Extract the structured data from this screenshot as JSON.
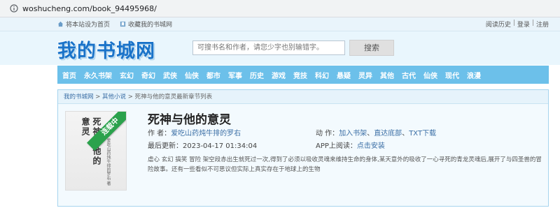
{
  "browser": {
    "url": "woshucheng.com/book_94495968/"
  },
  "topbar": {
    "set_home": "将本站设为首页",
    "bookmark": "收藏我的书城网",
    "history": "阅读历史",
    "sep1": "|",
    "login": "登录",
    "sep2": "|",
    "register": "注册"
  },
  "header": {
    "logo": "我的书城网",
    "search_placeholder": "可搜书名和作者，请您少字也别输错字。",
    "search_button": "搜索"
  },
  "nav": {
    "items": [
      "首页",
      "永久书架",
      "玄幻",
      "奇幻",
      "武侠",
      "仙侠",
      "都市",
      "军事",
      "历史",
      "游戏",
      "竞技",
      "科幻",
      "悬疑",
      "灵异",
      "其他",
      "古代",
      "仙侠",
      "现代",
      "浪漫"
    ]
  },
  "breadcrumb": {
    "home": "我的书城网",
    "sep1": " > ",
    "category": "其他小说",
    "sep2": " > ",
    "current": "死神与他的意灵最新章节列表"
  },
  "book": {
    "cover_line1": "意灵",
    "cover_line2": "死神与他的",
    "cover_author": "爱吃山药炖牛排的罗右 著",
    "ribbon": "连载中",
    "title": "死神与他的意灵",
    "author_label": "作    者：",
    "author": "爱吃山药炖牛排的罗右",
    "action_label": "动    作：",
    "action_shelf": "加入书架",
    "action_sep": "、",
    "action_bottom": "直达底部",
    "action_sep2": "、",
    "action_txt": "TXT下载",
    "update_label": "最后更新：",
    "update_time": "2023-04-17 01:34:04",
    "app_label": "APP上阅读：",
    "app_link": "点击安装",
    "description": "虐心 玄幻 搞笑 冒险 架空段赤出生就死过一次,得到了必须以吸收灵魂来维持生命的身体,某天意外的吸收了一心寻死的青龙灵魂后,展开了与四圣兽的冒险故事。还有一些看似不可思议但实际上真实存在于地球上的生物"
  }
}
